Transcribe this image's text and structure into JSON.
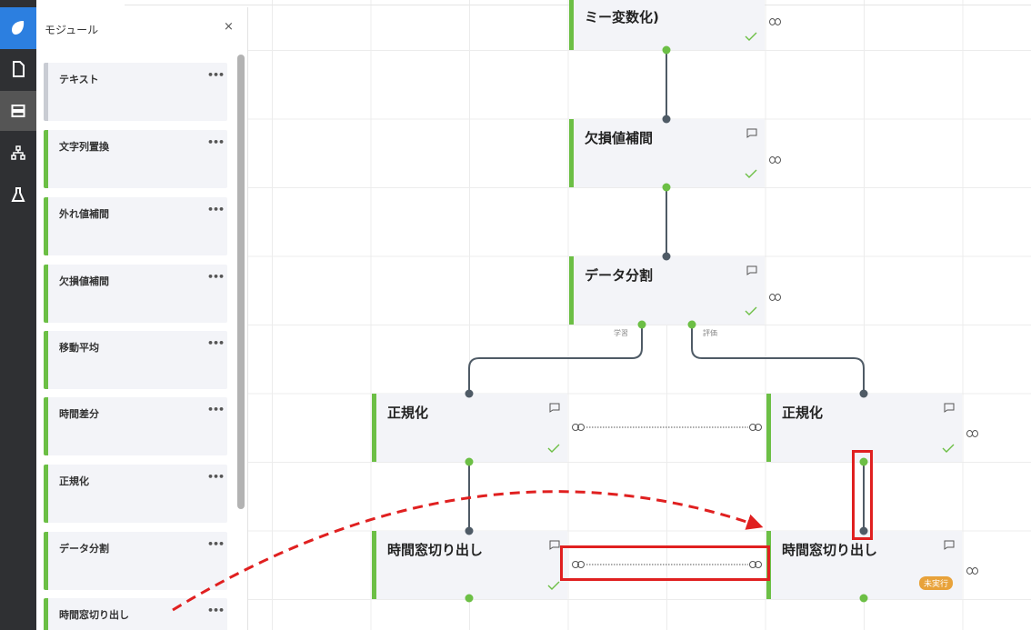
{
  "panel": {
    "title": "モジュール",
    "close_label": "×",
    "menu_label": "•••",
    "modules": [
      {
        "label": "テキスト",
        "color": "gray"
      },
      {
        "label": "文字列置換",
        "color": "green"
      },
      {
        "label": "外れ値補間",
        "color": "green"
      },
      {
        "label": "欠損値補間",
        "color": "green"
      },
      {
        "label": "移動平均",
        "color": "green"
      },
      {
        "label": "時間差分",
        "color": "green"
      },
      {
        "label": "正規化",
        "color": "green"
      },
      {
        "label": "データ分割",
        "color": "green"
      },
      {
        "label": "時間窓切り出し",
        "color": "green"
      }
    ]
  },
  "rail": {
    "icons": [
      "logo-icon",
      "document-icon",
      "storage-icon",
      "hierarchy-icon",
      "flask-icon"
    ],
    "active": "storage-icon"
  },
  "canvas": {
    "nodes": [
      {
        "id": "dummy",
        "title": "ミー変数化)",
        "status": "done"
      },
      {
        "id": "impute",
        "title": "欠損値補間",
        "status": "done"
      },
      {
        "id": "split",
        "title": "データ分割",
        "status": "done"
      },
      {
        "id": "norm-left",
        "title": "正規化",
        "status": "done"
      },
      {
        "id": "norm-right",
        "title": "正規化",
        "status": "done"
      },
      {
        "id": "window-left",
        "title": "時間窓切り出し",
        "status": "done"
      },
      {
        "id": "window-right",
        "title": "時間窓切り出し",
        "status": "not-run",
        "badge": "未実行"
      }
    ],
    "edge_labels": {
      "train": "学習",
      "eval": "評価"
    }
  },
  "colors": {
    "accent_green": "#6cbf45",
    "node_bg": "#f3f4f8",
    "edge": "#4f5b66",
    "highlight_red": "#e02020",
    "badge_orange": "#e8a23a",
    "logo_blue": "#2c7fe0"
  }
}
